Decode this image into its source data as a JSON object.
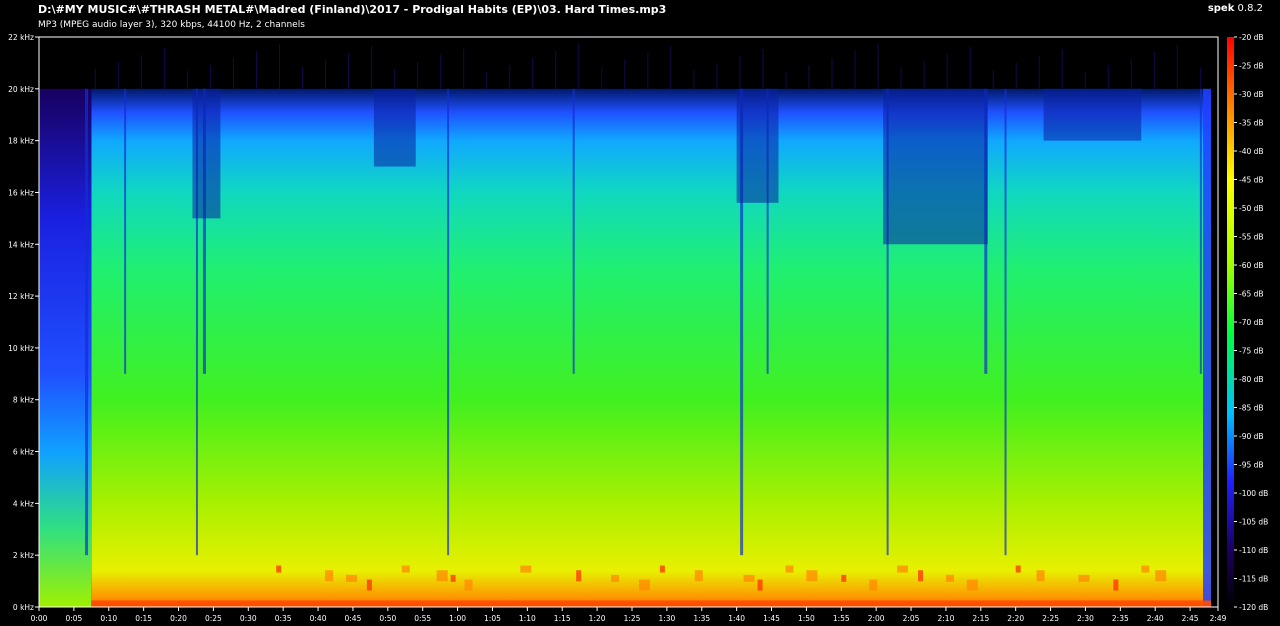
{
  "app": {
    "name": "spek",
    "version": "0.8.2"
  },
  "file_path": "D:\\#MY MUSIC#\\#THRASH METAL#\\Madred (Finland)\\2017 - Prodigal Habits (EP)\\03. Hard Times.mp3",
  "file_info": "MP3 (MPEG audio layer 3), 320 kbps, 44100 Hz, 2 channels",
  "colors": {
    "background": "#000000",
    "axis": "#ffffff"
  },
  "chart_data": {
    "type": "heatmap",
    "title": "D:\\#MY MUSIC#\\#THRASH METAL#\\Madred (Finland)\\2017 - Prodigal Habits (EP)\\03. Hard Times.mp3",
    "x_axis": {
      "unit": "seconds",
      "range": [
        0,
        169
      ],
      "ticks": [
        {
          "v": 0,
          "label": "0:00"
        },
        {
          "v": 5,
          "label": "0:05"
        },
        {
          "v": 10,
          "label": "0:10"
        },
        {
          "v": 15,
          "label": "0:15"
        },
        {
          "v": 20,
          "label": "0:20"
        },
        {
          "v": 25,
          "label": "0:25"
        },
        {
          "v": 30,
          "label": "0:30"
        },
        {
          "v": 35,
          "label": "0:35"
        },
        {
          "v": 40,
          "label": "0:40"
        },
        {
          "v": 45,
          "label": "0:45"
        },
        {
          "v": 50,
          "label": "0:50"
        },
        {
          "v": 55,
          "label": "0:55"
        },
        {
          "v": 60,
          "label": "1:00"
        },
        {
          "v": 65,
          "label": "1:05"
        },
        {
          "v": 70,
          "label": "1:10"
        },
        {
          "v": 75,
          "label": "1:15"
        },
        {
          "v": 80,
          "label": "1:20"
        },
        {
          "v": 85,
          "label": "1:25"
        },
        {
          "v": 90,
          "label": "1:30"
        },
        {
          "v": 95,
          "label": "1:35"
        },
        {
          "v": 100,
          "label": "1:40"
        },
        {
          "v": 105,
          "label": "1:45"
        },
        {
          "v": 110,
          "label": "1:50"
        },
        {
          "v": 115,
          "label": "1:55"
        },
        {
          "v": 120,
          "label": "2:00"
        },
        {
          "v": 125,
          "label": "2:05"
        },
        {
          "v": 130,
          "label": "2:10"
        },
        {
          "v": 135,
          "label": "2:15"
        },
        {
          "v": 140,
          "label": "2:20"
        },
        {
          "v": 145,
          "label": "2:25"
        },
        {
          "v": 150,
          "label": "2:30"
        },
        {
          "v": 155,
          "label": "2:35"
        },
        {
          "v": 160,
          "label": "2:40"
        },
        {
          "v": 165,
          "label": "2:45"
        },
        {
          "v": 169,
          "label": "2:49"
        }
      ]
    },
    "y_axis": {
      "unit": "kHz",
      "range": [
        0,
        22
      ],
      "ticks": [
        {
          "v": 0,
          "label": "0 kHz"
        },
        {
          "v": 2,
          "label": "2 kHz"
        },
        {
          "v": 4,
          "label": "4 kHz"
        },
        {
          "v": 6,
          "label": "6 kHz"
        },
        {
          "v": 8,
          "label": "8 kHz"
        },
        {
          "v": 10,
          "label": "10 kHz"
        },
        {
          "v": 12,
          "label": "12 kHz"
        },
        {
          "v": 14,
          "label": "14 kHz"
        },
        {
          "v": 16,
          "label": "16 kHz"
        },
        {
          "v": 18,
          "label": "18 kHz"
        },
        {
          "v": 20,
          "label": "20 kHz"
        },
        {
          "v": 22,
          "label": "22 kHz"
        }
      ]
    },
    "color_scale": {
      "unit": "dB",
      "range": [
        -120,
        -20
      ],
      "ticks": [
        "-20 dB",
        "-25 dB",
        "-30 dB",
        "-35 dB",
        "-40 dB",
        "-45 dB",
        "-50 dB",
        "-55 dB",
        "-60 dB",
        "-65 dB",
        "-70 dB",
        "-75 dB",
        "-80 dB",
        "-85 dB",
        "-90 dB",
        "-95 dB",
        "-100 dB",
        "-105 dB",
        "-110 dB",
        "-115 dB",
        "-120 dB"
      ],
      "stops": [
        "#000000",
        "#1a0050",
        "#2020ff",
        "#00a0ff",
        "#00ff60",
        "#a0ff00",
        "#ffff00",
        "#ff8000",
        "#ff0000"
      ]
    },
    "lowpass_cutoff_khz": 20,
    "content_end_seconds": 168
  }
}
